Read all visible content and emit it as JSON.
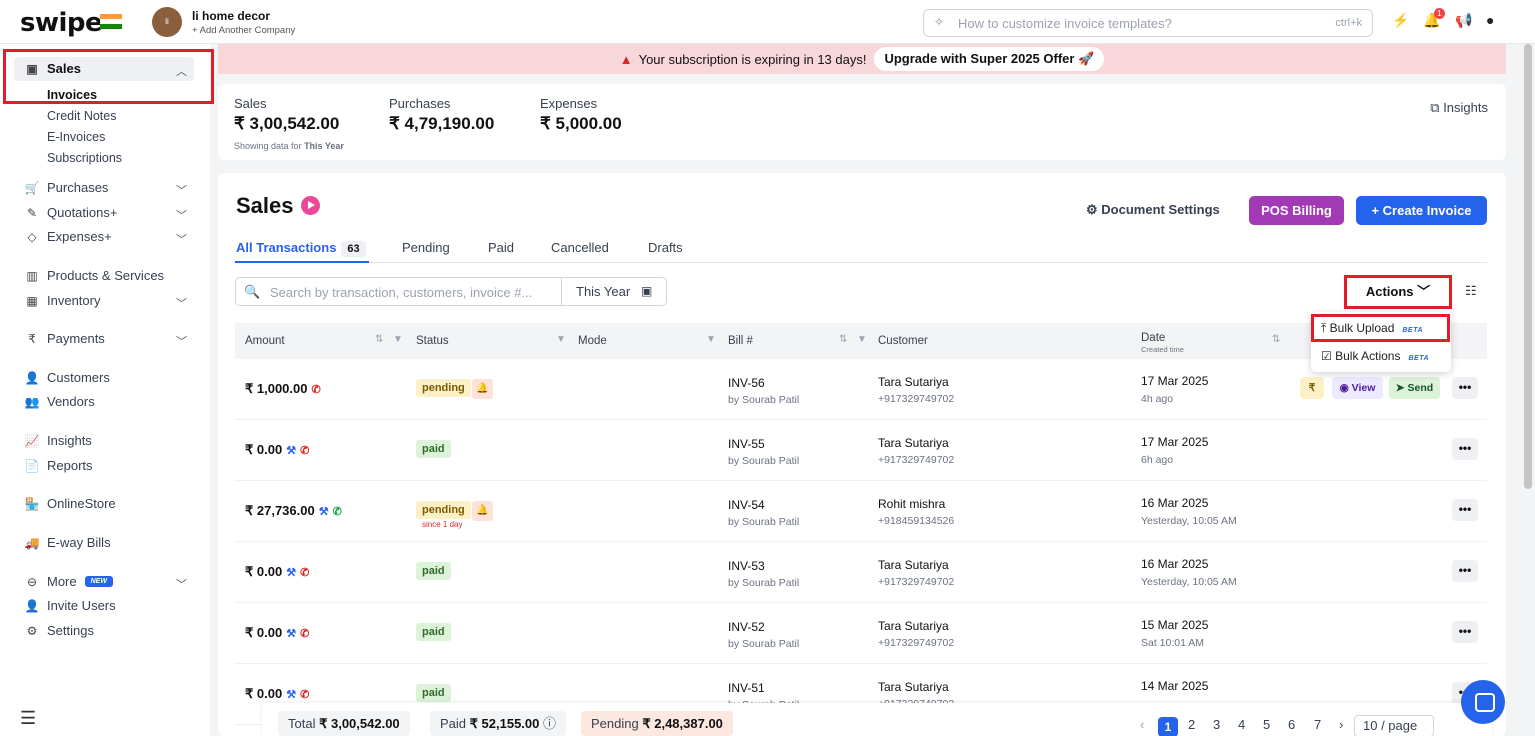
{
  "header": {
    "logo": "swipe",
    "company_initials": "li",
    "company_name": "li home decor",
    "add_company": "+ Add Another Company",
    "search_placeholder": "How to customize invoice templates?",
    "search_shortcut": "ctrl+k",
    "notification_count": "1"
  },
  "sidebar": {
    "sales_label": "Sales",
    "sales_sub": [
      "Invoices",
      "Credit Notes",
      "E-Invoices",
      "Subscriptions"
    ],
    "items": [
      {
        "label": "Purchases"
      },
      {
        "label": "Quotations+"
      },
      {
        "label": "Expenses+"
      },
      {
        "label": "Products & Services"
      },
      {
        "label": "Inventory"
      },
      {
        "label": "Payments"
      },
      {
        "label": "Customers"
      },
      {
        "label": "Vendors"
      },
      {
        "label": "Insights"
      },
      {
        "label": "Reports"
      },
      {
        "label": "OnlineStore"
      },
      {
        "label": "E-way Bills"
      },
      {
        "label": "More"
      },
      {
        "label": "Invite Users"
      },
      {
        "label": "Settings"
      }
    ],
    "new_badge": "NEW"
  },
  "banner": {
    "message": "Your subscription is expiring in 13 days!",
    "upgrade": "Upgrade with Super 2025 Offer 🚀"
  },
  "summary": {
    "sales_label": "Sales",
    "sales_value": "₹ 3,00,542.00",
    "purchases_label": "Purchases",
    "purchases_value": "₹ 4,79,190.00",
    "expenses_label": "Expenses",
    "expenses_value": "₹ 5,000.00",
    "note_prefix": "Showing data for",
    "note_period": "This Year",
    "insights": "Insights"
  },
  "main": {
    "title": "Sales",
    "document_settings": "Document Settings",
    "pos_billing": "POS Billing",
    "create_invoice": "+ Create Invoice",
    "tabs": [
      {
        "label": "All Transactions",
        "count": "63"
      },
      {
        "label": "Pending"
      },
      {
        "label": "Paid"
      },
      {
        "label": "Cancelled"
      },
      {
        "label": "Drafts"
      }
    ],
    "search_placeholder": "Search by transaction, customers, invoice #...",
    "period": "This Year",
    "actions": "Actions",
    "dropdown": [
      {
        "label": "Bulk Upload",
        "badge": "BETA"
      },
      {
        "label": "Bulk Actions",
        "badge": "BETA"
      }
    ],
    "columns": {
      "amount": "Amount",
      "status": "Status",
      "mode": "Mode",
      "bill": "Bill #",
      "customer": "Customer",
      "date": "Date",
      "date_sub": "Created time"
    },
    "row_actions": {
      "pay": "₹",
      "view": "View",
      "send": "Send"
    },
    "rows": [
      {
        "amount": "₹ 1,000.00",
        "status": "pending",
        "since": "",
        "bill": "INV-56",
        "by": "by Sourab Patil",
        "customer": "Tara Sutariya",
        "phone": "+917329749702",
        "date": "17 Mar 2025",
        "rel": "4h ago"
      },
      {
        "amount": "₹ 0.00",
        "status": "paid",
        "since": "",
        "bill": "INV-55",
        "by": "by Sourab Patil",
        "customer": "Tara Sutariya",
        "phone": "+917329749702",
        "date": "17 Mar 2025",
        "rel": "6h ago"
      },
      {
        "amount": "₹ 27,736.00",
        "status": "pending",
        "since": "since 1 day",
        "bill": "INV-54",
        "by": "by Sourab Patil",
        "customer": "Rohit mishra",
        "phone": "+918459134526",
        "date": "16 Mar 2025",
        "rel": "Yesterday, 10:05 AM"
      },
      {
        "amount": "₹ 0.00",
        "status": "paid",
        "since": "",
        "bill": "INV-53",
        "by": "by Sourab Patil",
        "customer": "Tara Sutariya",
        "phone": "+917329749702",
        "date": "16 Mar 2025",
        "rel": "Yesterday, 10:05 AM"
      },
      {
        "amount": "₹ 0.00",
        "status": "paid",
        "since": "",
        "bill": "INV-52",
        "by": "by Sourab Patil",
        "customer": "Tara Sutariya",
        "phone": "+917329749702",
        "date": "15 Mar 2025",
        "rel": "Sat 10:01 AM"
      },
      {
        "amount": "₹ 0.00",
        "status": "paid",
        "since": "",
        "bill": "INV-51",
        "by": "by Sourab Patil",
        "customer": "Tara Sutariya",
        "phone": "+917329749702",
        "date": "14 Mar 2025",
        "rel": ""
      }
    ]
  },
  "footer": {
    "total_label": "Total",
    "total_value": "₹ 3,00,542.00",
    "paid_label": "Paid",
    "paid_value": "₹ 52,155.00",
    "pending_label": "Pending",
    "pending_value": "₹ 2,48,387.00",
    "pages": [
      "1",
      "2",
      "3",
      "4",
      "5",
      "6",
      "7"
    ],
    "per_page": "10 / page"
  },
  "colors": {
    "accent": "#2563eb",
    "pos": "#a33ab5",
    "highlight": "#e11d2a",
    "banner": "#f8d7da"
  }
}
